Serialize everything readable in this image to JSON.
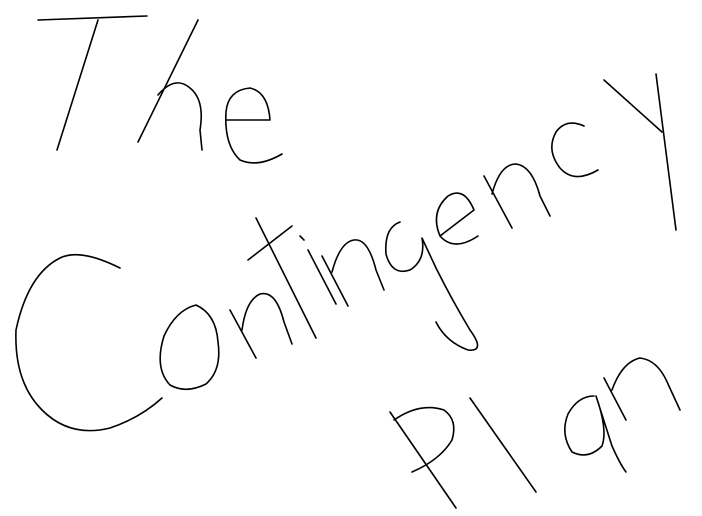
{
  "title": {
    "line1": "The",
    "line2": "Contingency",
    "line3": "Plan"
  },
  "colors": {
    "ink": "#000000",
    "paper": "#ffffff"
  }
}
